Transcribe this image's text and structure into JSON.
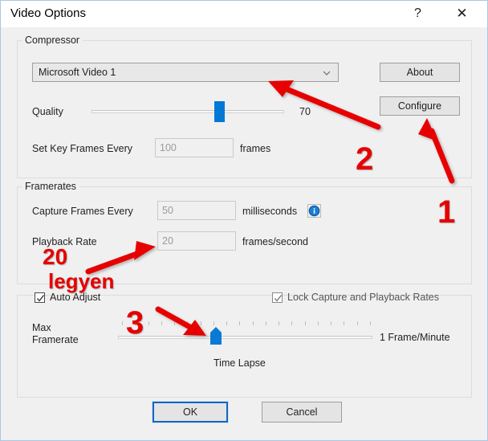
{
  "window": {
    "title": "Video Options",
    "help_glyph": "?",
    "close_glyph": "✕"
  },
  "compressor": {
    "group_label": "Compressor",
    "codec_selected": "Microsoft Video 1",
    "about_label": "About",
    "configure_label": "Configure",
    "quality_label": "Quality",
    "quality_value": "70",
    "keyframe_label": "Set Key Frames Every",
    "keyframe_value": "100",
    "keyframe_units": "frames"
  },
  "framerates": {
    "group_label": "Framerates",
    "capture_label": "Capture Frames Every",
    "capture_value": "50",
    "capture_units": "milliseconds",
    "info_icon": "info-icon",
    "playback_label": "Playback Rate",
    "playback_value": "20",
    "playback_units": "frames/second"
  },
  "timelapse": {
    "auto_adjust_label": "Auto Adjust",
    "auto_adjust_checked": true,
    "lock_rates_label": "Lock Capture and Playback Rates",
    "lock_rates_checked": true,
    "max_framerate_line1": "Max",
    "max_framerate_line2": "Framerate",
    "right_label": "1 Frame/Minute",
    "slider_caption": "Time Lapse"
  },
  "buttons": {
    "ok_label": "OK",
    "cancel_label": "Cancel"
  },
  "annotations": {
    "marker_1": "1",
    "marker_2": "2",
    "marker_3": "3",
    "note_value": "20",
    "note_word": "legyen",
    "color": "#e60000"
  }
}
